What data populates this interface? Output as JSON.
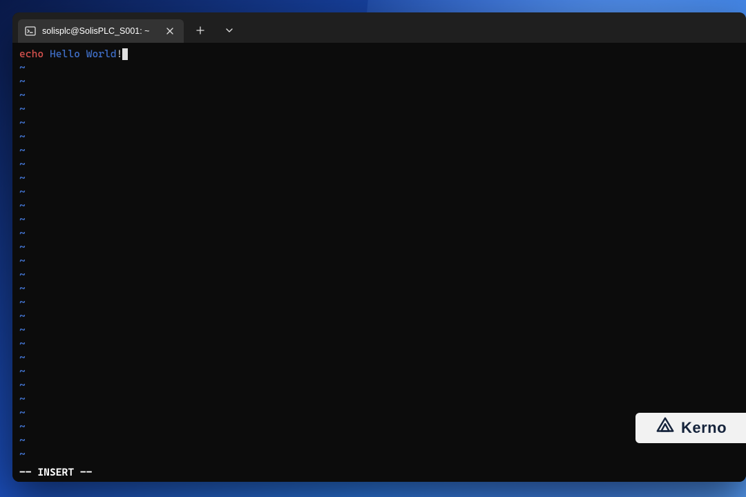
{
  "tab": {
    "title": "solisplc@SolisPLC_S001: ~",
    "icon": "terminal-icon"
  },
  "titlebar": {
    "new_tab_tooltip": "New tab",
    "dropdown_tooltip": "Open a new tab dropdown"
  },
  "editor": {
    "tokens": [
      {
        "text": "echo",
        "class": "tok-cmd"
      },
      {
        "text": " ",
        "class": ""
      },
      {
        "text": "Hello",
        "class": "tok-arg"
      },
      {
        "text": " ",
        "class": ""
      },
      {
        "text": "World",
        "class": "tok-arg"
      },
      {
        "text": "!",
        "class": "tok-punc"
      }
    ],
    "tilde": "~",
    "tilde_rows": 29,
    "status_line": "-- INSERT --"
  },
  "watermark": {
    "brand": "Kerno"
  }
}
